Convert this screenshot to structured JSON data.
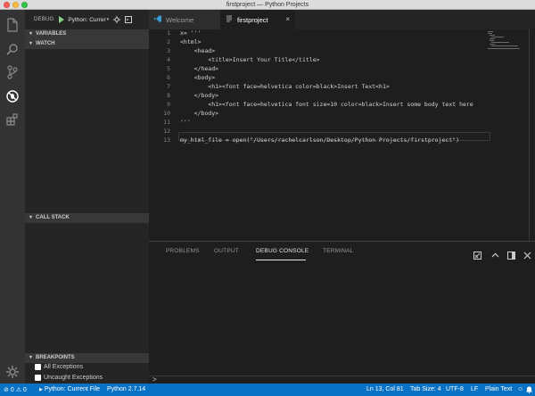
{
  "window": {
    "title": "firstproject — Python Projects"
  },
  "sidebar": {
    "debug_label": "DEBUG",
    "config_select": "Python: Currer",
    "sections": {
      "variables": "VARIABLES",
      "watch": "WATCH",
      "call_stack": "CALL STACK",
      "breakpoints": "BREAKPOINTS"
    },
    "breakpoints": [
      {
        "label": "All Exceptions"
      },
      {
        "label": "Uncaught Exceptions"
      }
    ]
  },
  "tabs": [
    {
      "label": "Welcome"
    },
    {
      "label": "firstproject"
    }
  ],
  "editor": {
    "line_numbers": [
      "1",
      "2",
      "3",
      "4",
      "5",
      "6",
      "7",
      "8",
      "9",
      "10",
      "11",
      "12",
      "13"
    ],
    "lines": [
      "x= '''",
      "<html>",
      "    <head>",
      "        <title>Insert Your Title</title>",
      "    </head>",
      "    <body>",
      "        <h1><font face=helvetica color=black>Insert Text<h1>",
      "    </body>",
      "        <h1><font face=helvetica font size=10 color=black>Insert some body text here",
      "    </body>",
      "'''",
      "",
      "my_html_file = open(\"/Users/rachelcarlson/Desktop/Python Projects/firstproject\")"
    ]
  },
  "panel": {
    "tabs": [
      "PROBLEMS",
      "OUTPUT",
      "DEBUG CONSOLE",
      "TERMINAL"
    ],
    "active_tab": "DEBUG CONSOLE",
    "prompt": ">"
  },
  "statusbar": {
    "errors": "0",
    "warnings": "0",
    "debug_config": "Python: Current File",
    "interpreter": "Python 2.7.14",
    "position": "Ln 13, Col 81",
    "tab_size": "Tab Size: 4",
    "encoding": "UTF-8",
    "eol": "LF",
    "language": "Plain Text"
  },
  "colors": {
    "statusbar": "#0a72c4",
    "activity_bar": "#333333",
    "sidebar": "#252526",
    "editor_bg": "#1e1e1e",
    "play": "#89d185"
  },
  "icons": [
    "explorer-icon",
    "search-icon",
    "source-control-icon",
    "debug-icon",
    "extensions-icon",
    "settings-icon",
    "play-icon",
    "gear-icon",
    "debug-console-icon",
    "error-icon",
    "warning-icon",
    "smiley-icon",
    "bell-icon"
  ]
}
